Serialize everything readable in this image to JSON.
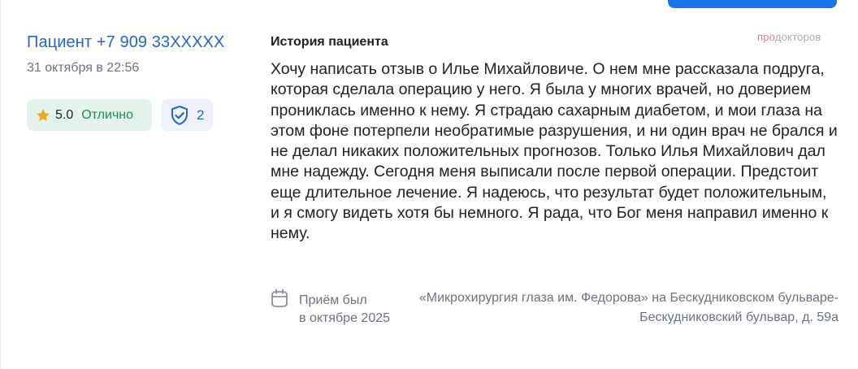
{
  "review": {
    "author": "Пациент +7 909 33XXXXX",
    "date": "31 октября в 22:56",
    "rating_value": "5.0",
    "rating_label": "Отлично",
    "verify_count": "2",
    "section_title": "История пациента",
    "brand_part1": "про",
    "brand_part2": "докторов",
    "text": "Хочу написать отзыв о Илье Михайловиче. О нем мне рассказала подруга, которая сделала операцию у него. Я была у многих врачей, но доверием прониклась именно к нему. Я страдаю сахарным диабетом, и мои глаза на этом фоне потерпели необратимые разрушения, и ни один врач не брался и не делал никаких положительных прогнозов. Только Илья Михайлович дал мне надежду. Сегодня меня выписали после первой операции. Предстоит еще длительное лечение. Я надеюсь, что результат будет положительным, и я смогу видеть хотя бы немного. Я рада, что Бог меня направил именно к нему.",
    "visit_label": "Приём был",
    "visit_date": "в октябре 2025",
    "clinic": "«Микрохирургия глаза им. Федорова» на Бескудниковском бульваре-Бескудниковский бульвар, д. 59а"
  },
  "icons": {
    "rating": "star-icon",
    "verify": "shield-check-icon",
    "visit": "calendar-icon"
  },
  "colors": {
    "author_link": "#2565c7",
    "rating_bg": "#e4f4ec",
    "rating_text": "#1e8a57",
    "star": "#f5a623",
    "verify_bg": "#eef3fb",
    "brand_pink": "#f27089"
  }
}
